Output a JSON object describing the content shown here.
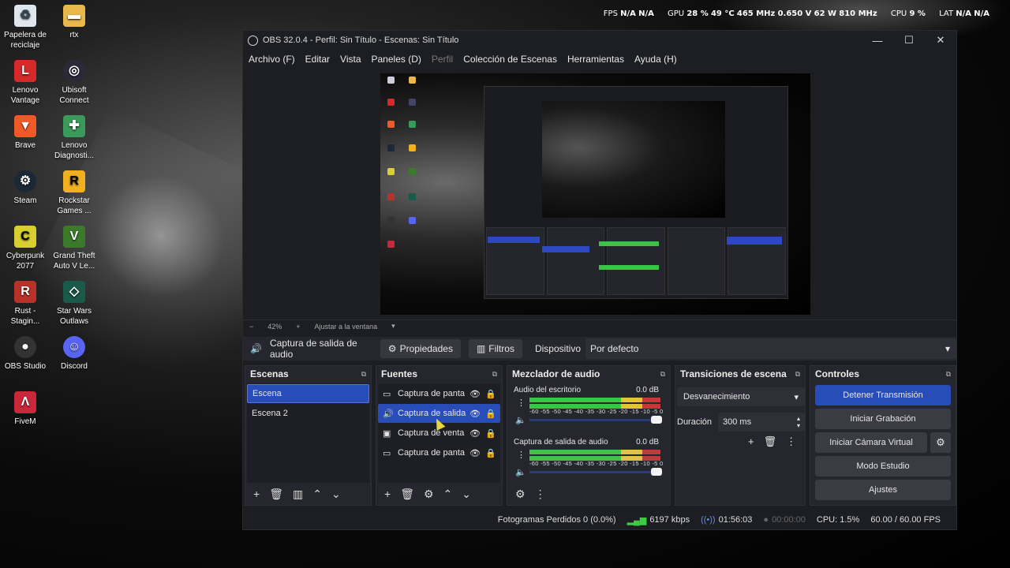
{
  "colors": {
    "accent_blue": "#284cb8",
    "meter_green": "#3cc444",
    "meter_yellow": "#e0c43c",
    "meter_red": "#c23a3a"
  },
  "system_stats": {
    "fps_label": "FPS",
    "fps_val1": "N/A",
    "fps_val2": "N/A",
    "gpu_label": "GPU",
    "gpu_load": "28 %",
    "gpu_temp": "49 °C",
    "gpu_clock": "465 MHz",
    "gpu_volt": "0.650 V",
    "gpu_power": "62 W",
    "gpu_mem": "810 MHz",
    "cpu_label": "CPU",
    "cpu_val": "9 %",
    "lat_label": "LAT",
    "lat_val1": "N/A",
    "lat_val2": "N/A"
  },
  "desktop": {
    "icons": [
      {
        "label": "Papelera de reciclaje",
        "icon": "recycle-bin-icon"
      },
      {
        "label": "rtx",
        "icon": "folder-icon"
      },
      {
        "label": "Lenovo Vantage",
        "icon": "lenovo-vantage-icon"
      },
      {
        "label": "Ubisoft Connect",
        "icon": "ubisoft-icon"
      },
      {
        "label": "Brave",
        "icon": "brave-icon"
      },
      {
        "label": "Lenovo Diagnosti...",
        "icon": "lenovo-diagnostics-icon"
      },
      {
        "label": "Steam",
        "icon": "steam-icon"
      },
      {
        "label": "Rockstar Games ...",
        "icon": "rockstar-icon"
      },
      {
        "label": "Cyberpunk 2077",
        "icon": "cyberpunk-icon"
      },
      {
        "label": "Grand Theft Auto V Le...",
        "icon": "gta-icon"
      },
      {
        "label": "Rust - Stagin...",
        "icon": "rust-icon"
      },
      {
        "label": "Star Wars Outlaws",
        "icon": "star-wars-icon"
      },
      {
        "label": "OBS Studio",
        "icon": "obs-icon"
      },
      {
        "label": "Discord",
        "icon": "discord-icon"
      },
      {
        "label": "FiveM",
        "icon": "fivem-icon"
      }
    ]
  },
  "window": {
    "title": "OBS 32.0.4 - Perfil: Sin Título - Escenas: Sin Título",
    "minimize": "—",
    "maximize": "☐",
    "close": "✕"
  },
  "menu": {
    "archivo": "Archivo (F)",
    "editar": "Editar",
    "vista": "Vista",
    "paneles": "Paneles (D)",
    "perfil": "Perfil",
    "coleccion": "Colección de Escenas",
    "herramientas": "Herramientas",
    "ayuda": "Ayuda (H)"
  },
  "zoom": {
    "minus": "−",
    "value": "42%",
    "plus": "+",
    "fit_label": "Ajustar a la ventana",
    "dropdown": "▾"
  },
  "source_toolbar": {
    "source_name": "Captura de salida de audio",
    "properties": "Propiedades",
    "filters": "Filtros",
    "device_label": "Dispositivo",
    "device_value": "Por defecto"
  },
  "scenes": {
    "title": "Escenas",
    "items": [
      "Escena",
      "Escena 2"
    ]
  },
  "sources": {
    "title": "Fuentes",
    "items": [
      {
        "name": "Captura de panta",
        "icon": "monitor-icon"
      },
      {
        "name": "Captura de salida",
        "icon": "speaker-icon"
      },
      {
        "name": "Captura de venta",
        "icon": "window-icon"
      },
      {
        "name": "Captura de panta",
        "icon": "monitor-icon"
      }
    ]
  },
  "mixer": {
    "title": "Mezclador de audio",
    "ticks": "-60 -55 -50 -45 -40 -35 -30 -25 -20 -15 -10 -5 0",
    "tracks": [
      {
        "name": "Audio del escritorio",
        "db": "0.0 dB",
        "level": 1.0
      },
      {
        "name": "Captura de salida de audio",
        "db": "0.0 dB",
        "level": 1.0
      }
    ]
  },
  "transitions": {
    "title": "Transiciones de escena",
    "selected": "Desvanecimiento",
    "duration_label": "Duración",
    "duration_value": "300 ms"
  },
  "controls": {
    "title": "Controles",
    "stop_stream": "Detener Transmisión",
    "start_rec": "Iniciar Grabación",
    "virtual_cam": "Iniciar Cámara Virtual",
    "studio_mode": "Modo Estudio",
    "settings": "Ajustes"
  },
  "status": {
    "dropped": "Fotogramas Perdidos 0 (0.0%)",
    "bitrate": "6197 kbps",
    "stream_time": "01:56:03",
    "rec_time": "00:00:00",
    "cpu": "CPU: 1.5%",
    "fps": "60.00 / 60.00 FPS"
  }
}
